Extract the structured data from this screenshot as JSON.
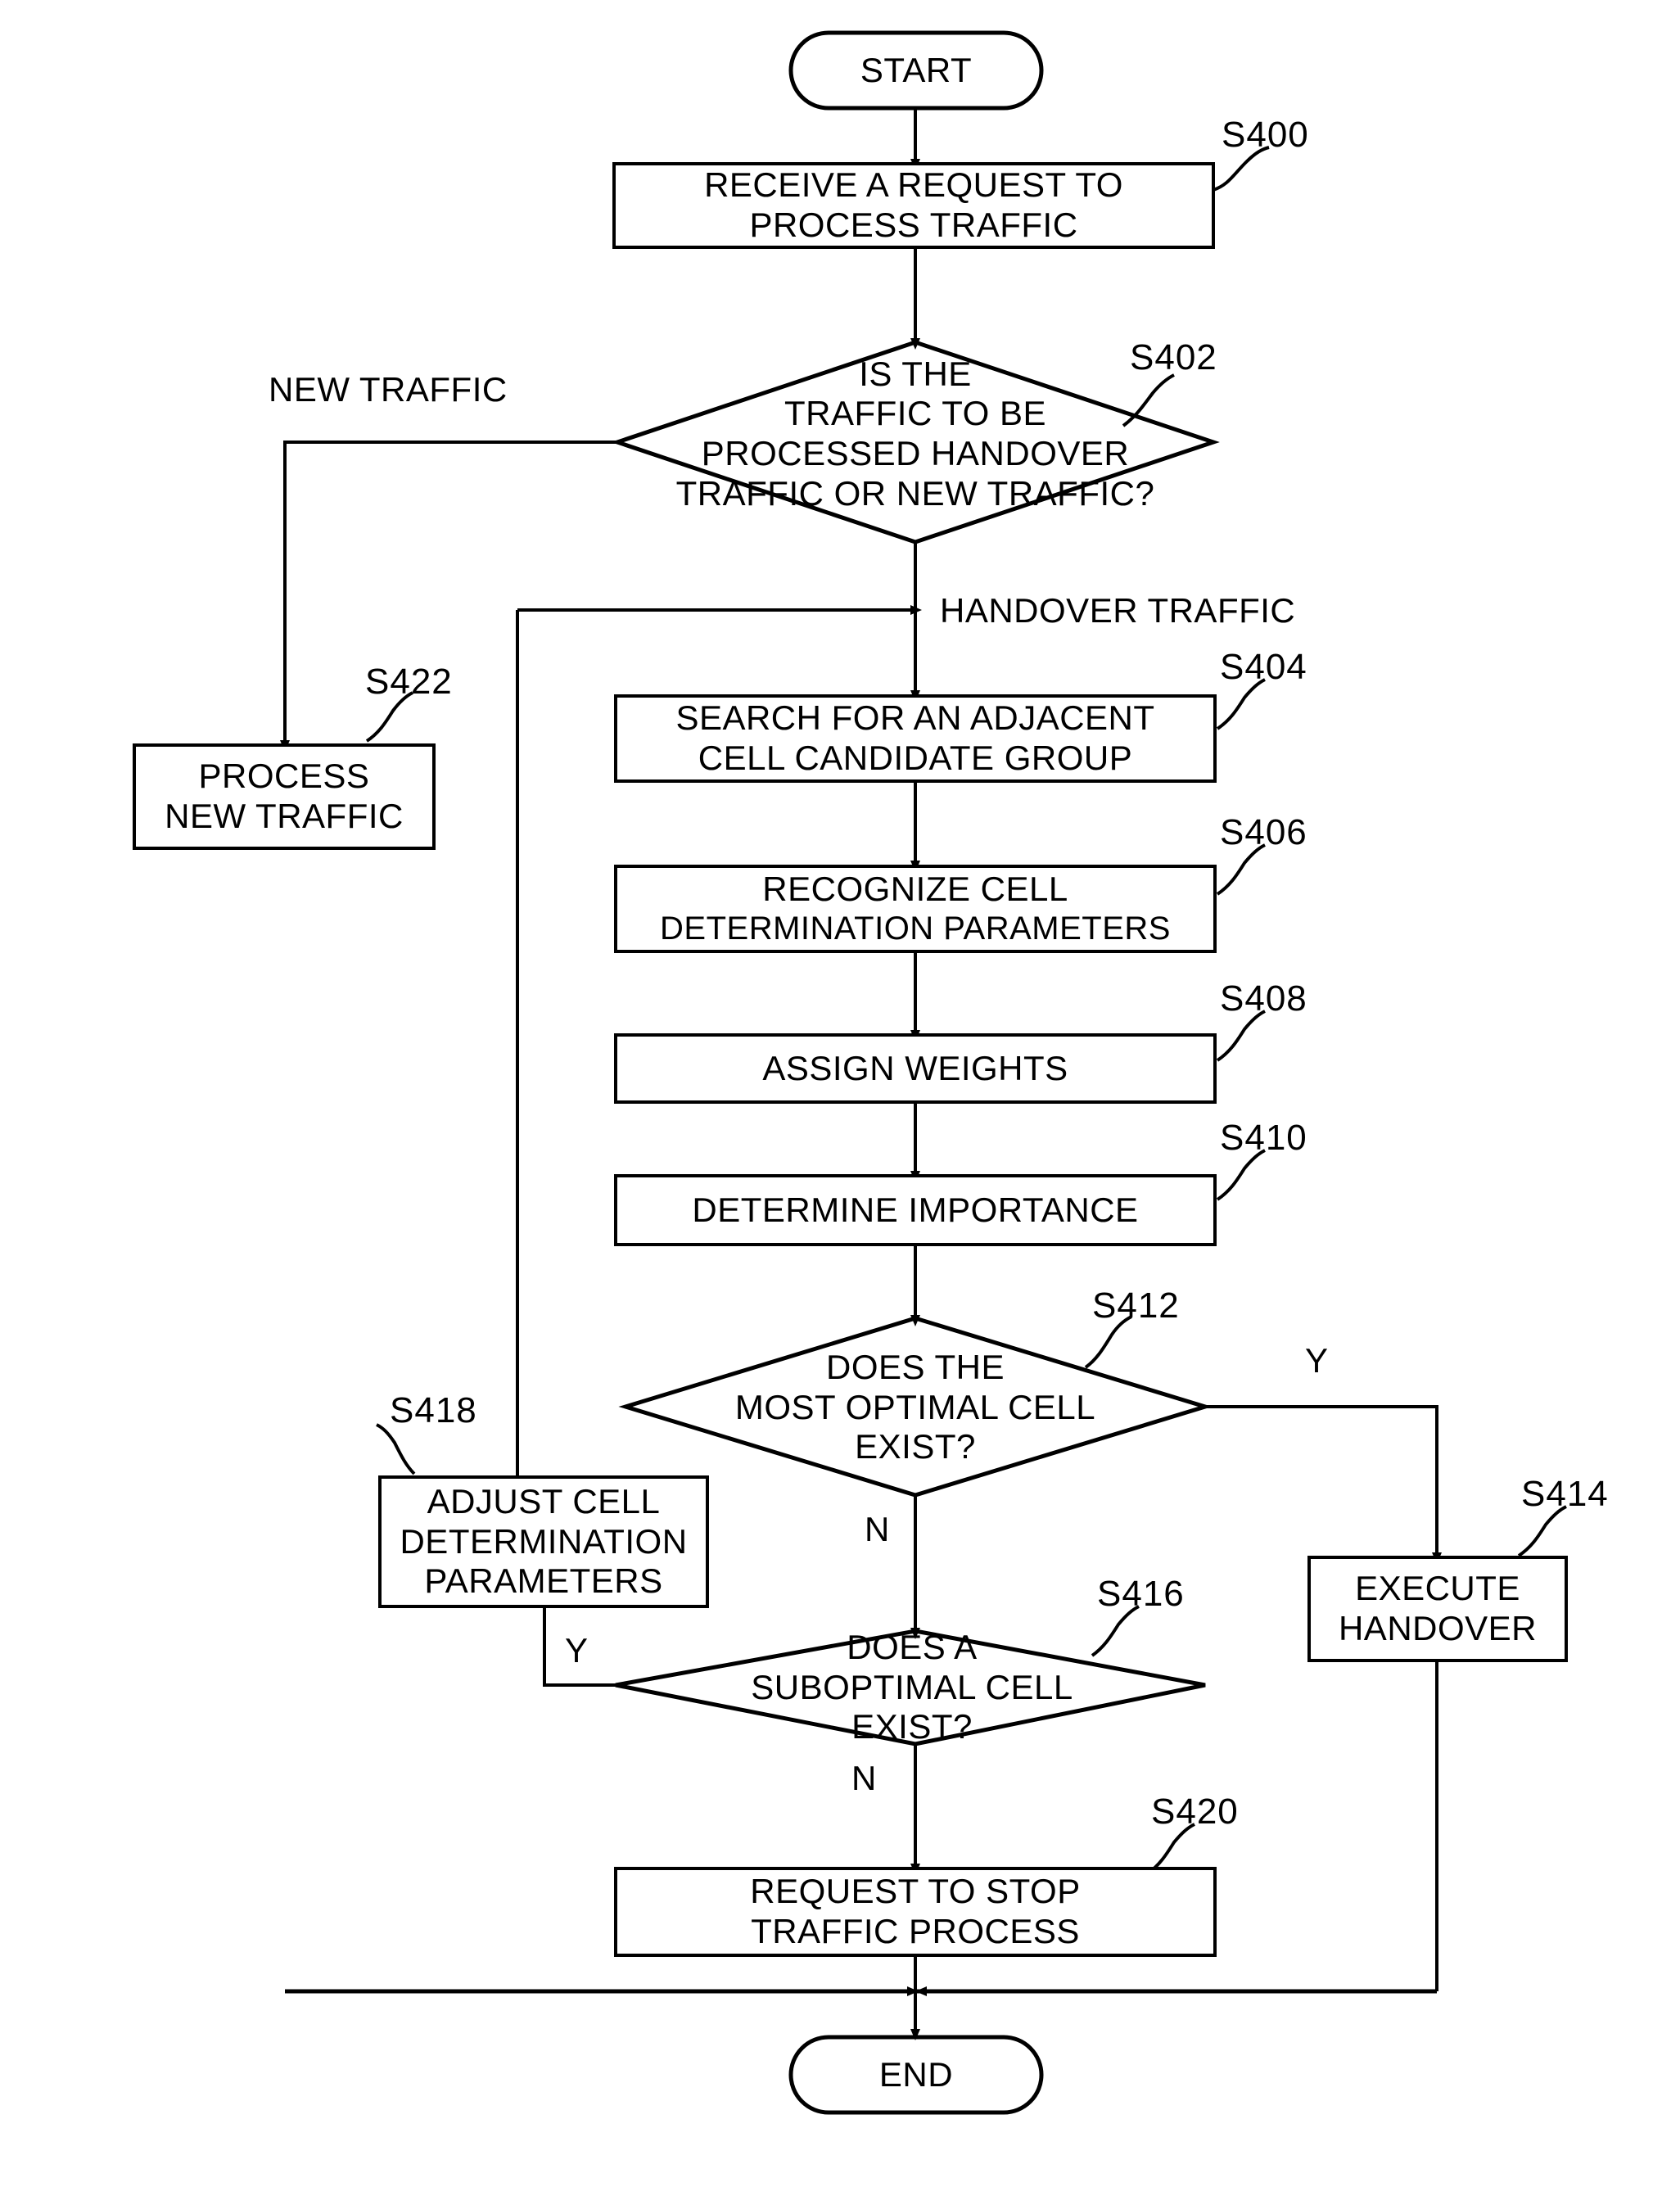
{
  "figure": {
    "type": "flowchart",
    "title": "Handover traffic processing flowchart"
  },
  "nodes": {
    "start": {
      "label": "START",
      "shape": "terminator",
      "ref": ""
    },
    "s400": {
      "label": "RECEIVE A REQUEST TO\nPROCESS TRAFFIC",
      "line1": "RECEIVE A REQUEST TO",
      "line2": "PROCESS TRAFFIC",
      "shape": "process",
      "ref": "S400"
    },
    "s402": {
      "line1": "IS THE",
      "line2": "TRAFFIC TO BE",
      "line3": "PROCESSED HANDOVER",
      "line4": "TRAFFIC OR NEW TRAFFIC?",
      "shape": "decision",
      "ref": "S402"
    },
    "s422": {
      "line1": "PROCESS",
      "line2": "NEW TRAFFIC",
      "shape": "process",
      "ref": "S422"
    },
    "s404": {
      "line1": "SEARCH FOR AN ADJACENT",
      "line2": "CELL CANDIDATE GROUP",
      "shape": "process",
      "ref": "S404"
    },
    "s406": {
      "line1": "RECOGNIZE CELL",
      "line2": "DETERMINATION PARAMETERS",
      "shape": "process",
      "ref": "S406"
    },
    "s408": {
      "line1": "ASSIGN WEIGHTS",
      "shape": "process",
      "ref": "S408"
    },
    "s410": {
      "line1": "DETERMINE IMPORTANCE",
      "shape": "process",
      "ref": "S410"
    },
    "s412": {
      "line1": "DOES THE",
      "line2": "MOST OPTIMAL CELL",
      "line3": "EXIST?",
      "shape": "decision",
      "ref": "S412"
    },
    "s414": {
      "line1": "EXECUTE",
      "line2": "HANDOVER",
      "shape": "process",
      "ref": "S414"
    },
    "s416": {
      "line1": "DOES A",
      "line2": "SUBOPTIMAL CELL",
      "line3": "EXIST?",
      "shape": "decision",
      "ref": "S416"
    },
    "s418": {
      "line1": "ADJUST CELL",
      "line2": "DETERMINATION",
      "line3": "PARAMETERS",
      "shape": "process",
      "ref": "S418"
    },
    "s420": {
      "line1": "REQUEST TO STOP",
      "line2": "TRAFFIC PROCESS",
      "shape": "process",
      "ref": "S420"
    },
    "end": {
      "label": "END",
      "shape": "terminator",
      "ref": ""
    }
  },
  "edge_labels": {
    "new_traffic": "NEW TRAFFIC",
    "handover_traffic": "HANDOVER TRAFFIC",
    "s412_yes": "Y",
    "s412_no": "N",
    "s416_yes": "Y",
    "s416_no": "N"
  },
  "refs": {
    "s400": "S400",
    "s402": "S402",
    "s404": "S404",
    "s406": "S406",
    "s408": "S408",
    "s410": "S410",
    "s412": "S412",
    "s414": "S414",
    "s416": "S416",
    "s418": "S418",
    "s420": "S420",
    "s422": "S422"
  },
  "colors": {
    "stroke": "#000000",
    "background": "#ffffff"
  }
}
